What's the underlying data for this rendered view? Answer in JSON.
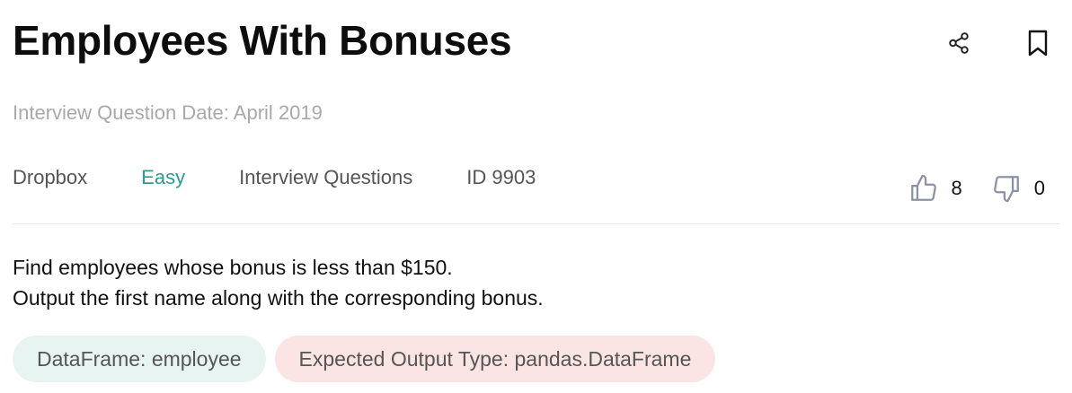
{
  "question": {
    "title": "Employees With Bonuses",
    "date": "Interview Question Date: April 2019",
    "company": "Dropbox",
    "difficulty": "Easy",
    "category": "Interview Questions",
    "id": "ID 9903",
    "upvotes": "8",
    "downvotes": "0",
    "description": [
      "Find employees whose bonus is less than $150.",
      "Output the first name along with the corresponding bonus."
    ],
    "tags": {
      "dataframe": "DataFrame: employee",
      "output_type": "Expected Output Type: pandas.DataFrame"
    }
  },
  "icons": {
    "share": "share-icon",
    "bookmark": "bookmark-icon",
    "upvote": "thumbs-up-icon",
    "downvote": "thumbs-down-icon"
  },
  "colors": {
    "difficulty_easy": "#2a9d8f",
    "date_text": "#a9a9a9",
    "dataframe_chip_bg": "#e8f4f2",
    "output_chip_bg": "#fbe4e4"
  }
}
